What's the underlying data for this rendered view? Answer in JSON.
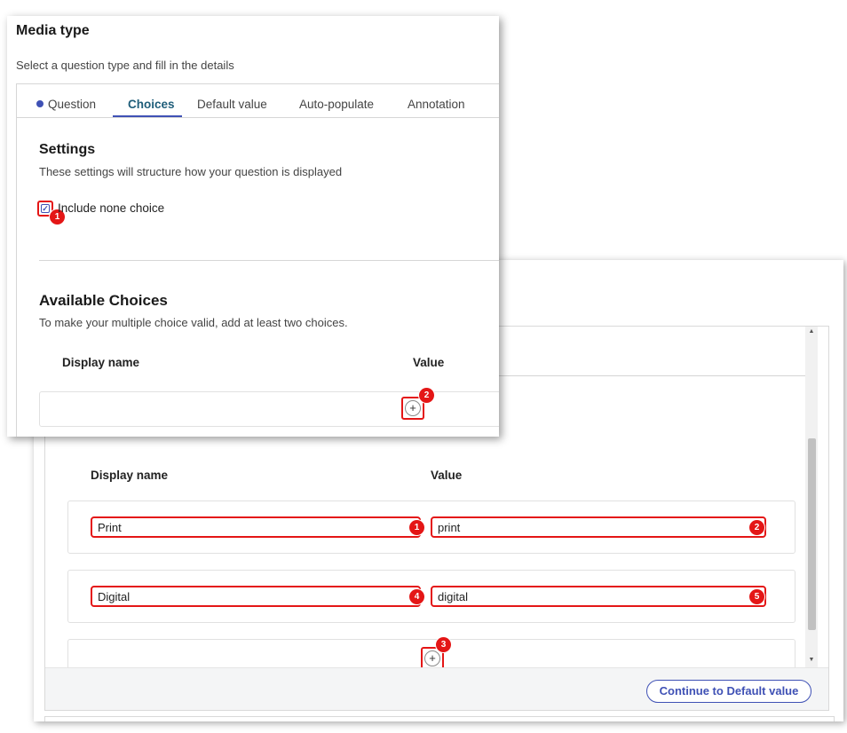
{
  "front": {
    "title": "Media type",
    "subtitle": "Select a question type and fill in the details",
    "tabs": [
      {
        "label": "Question",
        "status": "dot"
      },
      {
        "label": "Choices",
        "active": true
      },
      {
        "label": "Default value"
      },
      {
        "label": "Auto-populate"
      },
      {
        "label": "Annotation"
      }
    ],
    "settings": {
      "title": "Settings",
      "description": "These settings will structure how your question is displayed",
      "include_none_label": "Include none choice",
      "include_none_checked": true
    },
    "available_choices": {
      "title": "Available Choices",
      "description": "To make your multiple choice valid, add at least two choices.",
      "col_display": "Display name",
      "col_value": "Value"
    },
    "callouts": {
      "checkbox": "1",
      "add": "2"
    },
    "add_glyph": "+"
  },
  "back": {
    "col_display": "Display name",
    "col_value": "Value",
    "rows": [
      {
        "display": "Print",
        "value": "print",
        "display_callout": "1",
        "value_callout": "2"
      },
      {
        "display": "Digital",
        "value": "digital",
        "display_callout": "4",
        "value_callout": "5"
      }
    ],
    "add_callout": "3",
    "add_glyph": "+",
    "continue_label": "Continue to Default value"
  },
  "colors": {
    "accent": "#3f51b5",
    "callout": "#e41616",
    "tab_active_text": "#1f5e7a"
  },
  "icons": {
    "checkbox": "checkbox-checked-icon",
    "add": "plus-circle-icon",
    "scroll_up": "chevron-up-icon",
    "scroll_down": "chevron-down-icon"
  }
}
